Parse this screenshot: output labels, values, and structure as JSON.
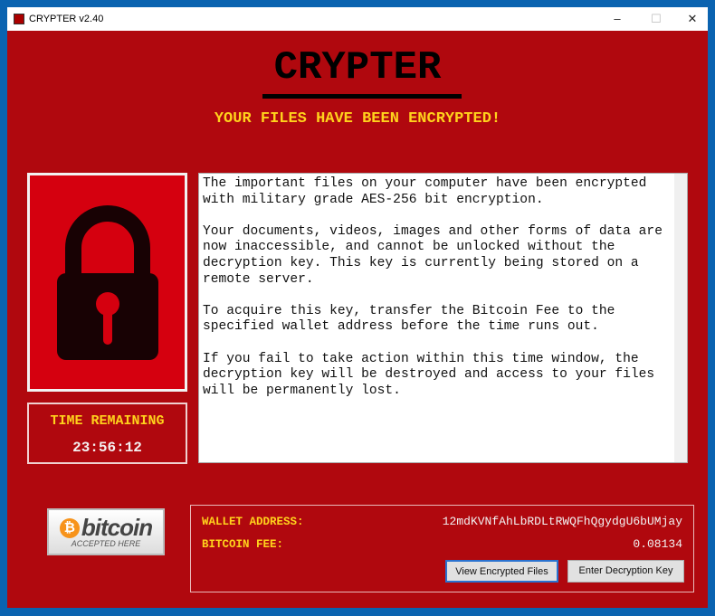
{
  "window": {
    "title": "CRYPTER v2.40",
    "minimize": "–",
    "maximize": "☐",
    "close": "✕"
  },
  "header": {
    "title": "CRYPTER",
    "subtitle": "YOUR FILES HAVE BEEN ENCRYPTED!"
  },
  "colors": {
    "background": "#b0080e",
    "accent": "#ffd21c"
  },
  "timer": {
    "label": "TIME REMAINING",
    "value": "23:56:12"
  },
  "message": {
    "paragraphs": [
      "The important files on your computer have been encrypted with military grade AES-256 bit encryption.",
      "Your documents, videos, images and other forms of data are now inaccessible, and cannot be unlocked without the decryption key. This key is currently being stored on a remote server.",
      "To acquire this key, transfer the Bitcoin Fee to the specified wallet address before the time runs out.",
      "If you fail to take action within this time window, the decryption key will be destroyed and access to your files will be permanently lost."
    ]
  },
  "bitcoin_logo": {
    "symbol": "₿",
    "word": "bitcoin",
    "tagline": "ACCEPTED HERE"
  },
  "payment": {
    "wallet_label": "WALLET ADDRESS:",
    "wallet_value": "12mdKVNfAhLbRDLtRWQFhQgydgU6bUMjay",
    "fee_label": "BITCOIN FEE:",
    "fee_value": "0.08134"
  },
  "buttons": {
    "view": "View Encrypted Files",
    "enter": "Enter Decryption Key"
  }
}
